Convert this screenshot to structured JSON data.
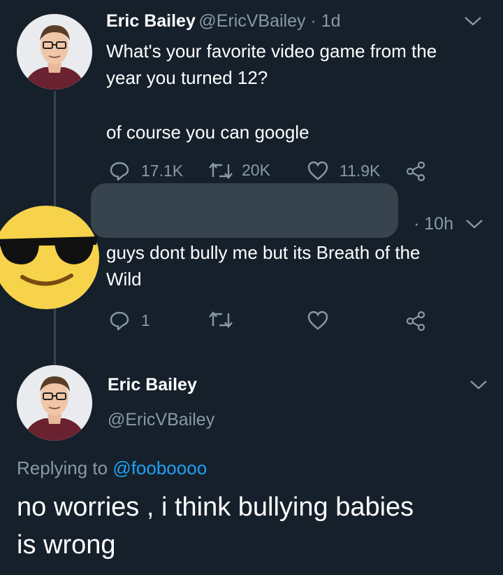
{
  "tweet1": {
    "name": "Eric Bailey",
    "meta": "@EricVBailey · 1d",
    "text_line1": "What's your favorite video game from the",
    "text_line2": "year you turned 12?",
    "text_line3": "of course you can google",
    "replies": "17.1K",
    "retweets": "20K",
    "likes": "11.9K"
  },
  "tweet2": {
    "meta": "· 10h",
    "text_line1": "guys dont bully me but its Breath of the",
    "text_line2": "Wild",
    "replies": "1"
  },
  "tweet3": {
    "name": "Eric Bailey",
    "handle": "@EricVBailey",
    "replying_label": "Replying to",
    "replying_to": "@fooboooo",
    "text_line1": "no worries , i think bullying babies",
    "text_line2": "is wrong"
  },
  "colors": {
    "background": "#15202b",
    "muted": "#8899a6",
    "link": "#1da1f2",
    "emoji": "#f6d34a"
  }
}
